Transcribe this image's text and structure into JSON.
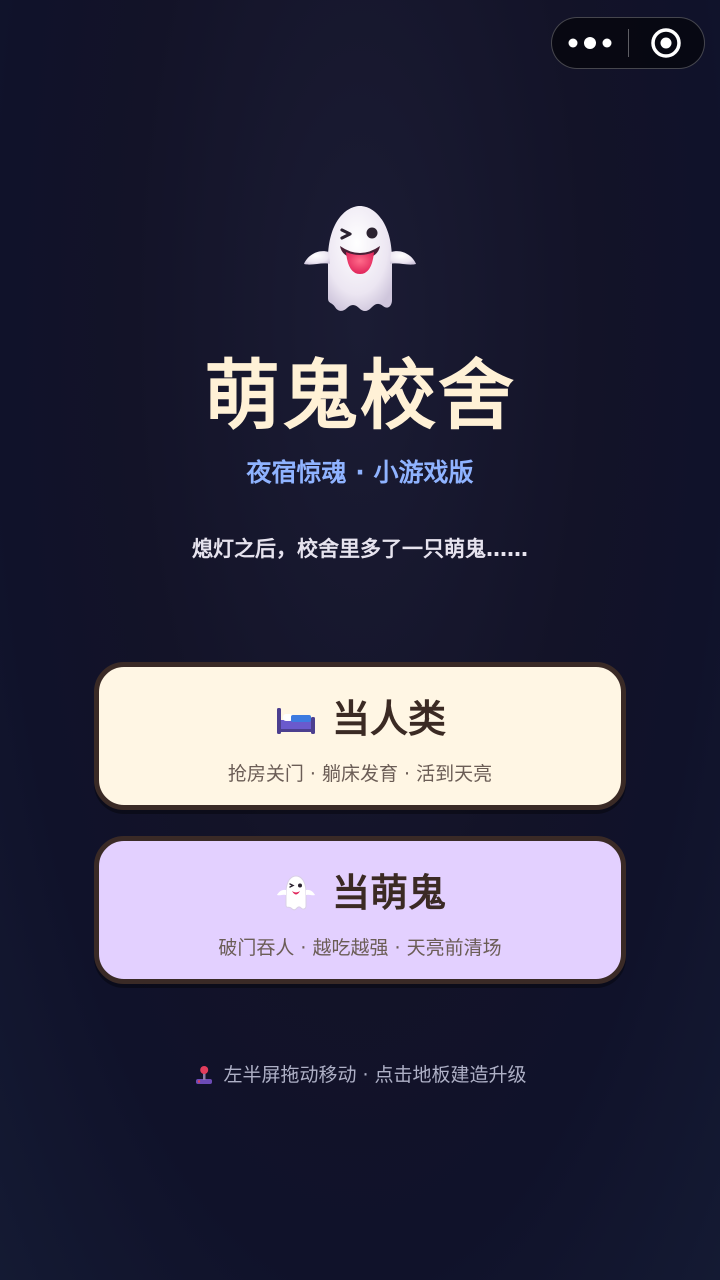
{
  "capsule": {
    "more_icon": "more-dots-icon",
    "close_icon": "target-close-icon"
  },
  "hero": {
    "icon": "winking-ghost-icon",
    "title": "萌鬼校舍",
    "subtitle": "夜宿惊魂 · 小游戏版",
    "tagline": "熄灯之后，校舍里多了一只萌鬼……"
  },
  "modes": [
    {
      "icon": "bed-icon",
      "label": "当人类",
      "desc": "抢房关门 · 躺床发育 · 活到天亮",
      "bg_color": "#fff6e4"
    },
    {
      "icon": "ghost-icon",
      "label": "当萌鬼",
      "desc": "破门吞人 · 越吃越强 · 天亮前清场",
      "bg_color": "#e3d0ff"
    }
  ],
  "hint": {
    "icon": "joystick-icon",
    "text": "左半屏拖动移动 · 点击地板建造升级"
  },
  "colors": {
    "title": "#fff1d6",
    "subtitle": "#8fb3ff",
    "button_border": "#3a2a26"
  }
}
